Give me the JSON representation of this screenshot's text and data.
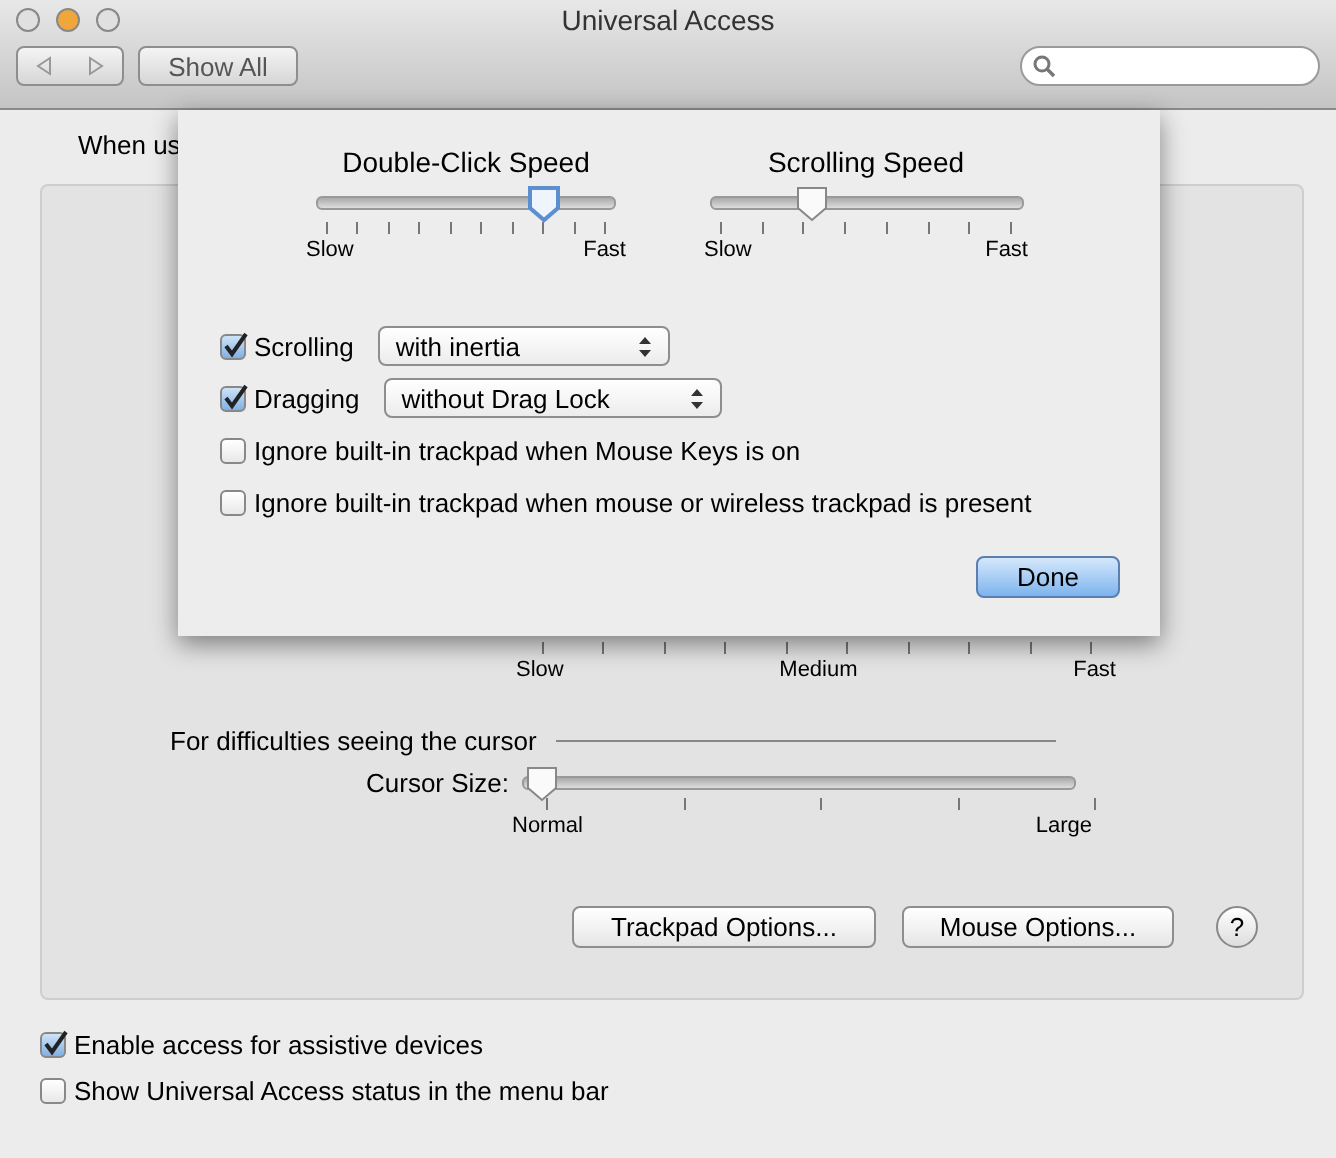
{
  "window": {
    "title": "Universal Access"
  },
  "toolbar": {
    "show_all": "Show All"
  },
  "intro_fragment": "When us",
  "panel": {
    "speed_labels": [
      "Slow",
      "Medium",
      "Fast"
    ],
    "cursor_section": {
      "heading": "For difficulties seeing the cursor",
      "label": "Cursor Size:",
      "level": 0,
      "labels": [
        "Normal",
        "Large"
      ]
    },
    "buttons": [
      "Trackpad Options...",
      "Mouse Options..."
    ],
    "help": "?"
  },
  "options": [
    {
      "label": "Enable access for assistive devices",
      "checked": true
    },
    {
      "label": "Show Universal Access status in the menu bar",
      "checked": false
    }
  ],
  "sheet": {
    "sliders": [
      {
        "title": "Double-Click Speed",
        "level": 0.8,
        "labels": [
          "Slow",
          "Fast"
        ]
      },
      {
        "title": "Scrolling Speed",
        "level": 0.3,
        "labels": [
          "Slow",
          "Fast"
        ]
      }
    ],
    "rows": [
      {
        "kind": "popup",
        "label": "Scrolling",
        "checked": true,
        "value": "with inertia"
      },
      {
        "kind": "popup",
        "label": "Dragging",
        "checked": true,
        "value": "without Drag Lock"
      },
      {
        "kind": "plain",
        "label": "Ignore built-in trackpad when Mouse Keys is on",
        "checked": false
      },
      {
        "kind": "plain",
        "label": "Ignore built-in trackpad when mouse or wireless trackpad is present",
        "checked": false
      }
    ],
    "done": "Done"
  }
}
